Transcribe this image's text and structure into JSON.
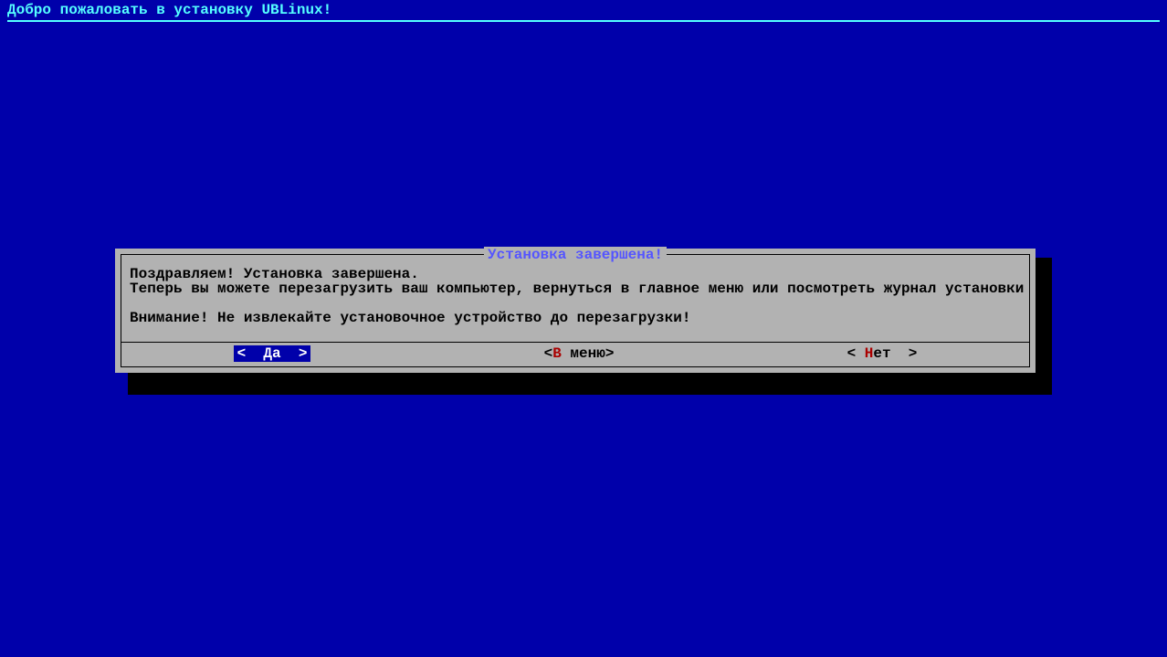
{
  "header": "Добро пожаловать в установку UBLinux!",
  "dialog": {
    "title": "Установка завершена!",
    "line1": "Поздравляем! Установка завершена.",
    "line2": "Теперь вы можете перезагрузить ваш компьютер, вернуться в главное меню или посмотреть журнал установки",
    "line3": "Внимание! Не извлекайте установочное устройство до перезагрузки!",
    "buttons": {
      "yes": {
        "open": "<  ",
        "hot": "Д",
        "rest": "а",
        "close": "  >"
      },
      "menu": {
        "open": "<",
        "hot": "В",
        "rest": " меню",
        "close": ">"
      },
      "no": {
        "open": "< ",
        "hot": "Н",
        "rest": "ет",
        "close": "  >"
      }
    }
  }
}
